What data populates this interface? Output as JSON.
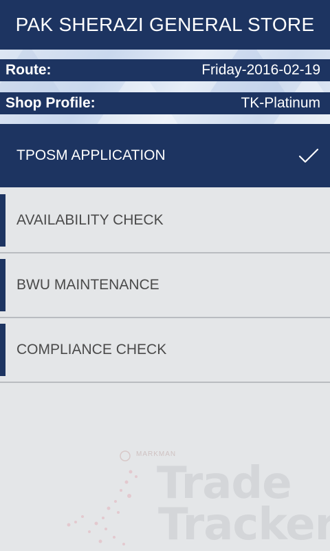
{
  "header": {
    "title": "PAK SHERAZI GENERAL STORE"
  },
  "info": {
    "route_label": "Route:",
    "route_value": "Friday-2016-02-19",
    "shop_profile_label": "Shop Profile:",
    "shop_profile_value": "TK-Platinum"
  },
  "menu": {
    "items": [
      {
        "label": "TPOSM APPLICATION",
        "state": "selected",
        "icon": "checkmark-icon"
      },
      {
        "label": "AVAILABILITY CHECK",
        "state": "normal"
      },
      {
        "label": "BWU MAINTENANCE",
        "state": "normal"
      },
      {
        "label": "COMPLIANCE CHECK",
        "state": "normal"
      }
    ]
  },
  "watermark": {
    "brand": "MARKMAN",
    "line1": "Trade",
    "line2": "Tracker"
  },
  "colors": {
    "primary": "#1d3461",
    "background": "#e4e6e8",
    "text_muted": "#4a4a4a",
    "divider": "#b9bcc0"
  }
}
